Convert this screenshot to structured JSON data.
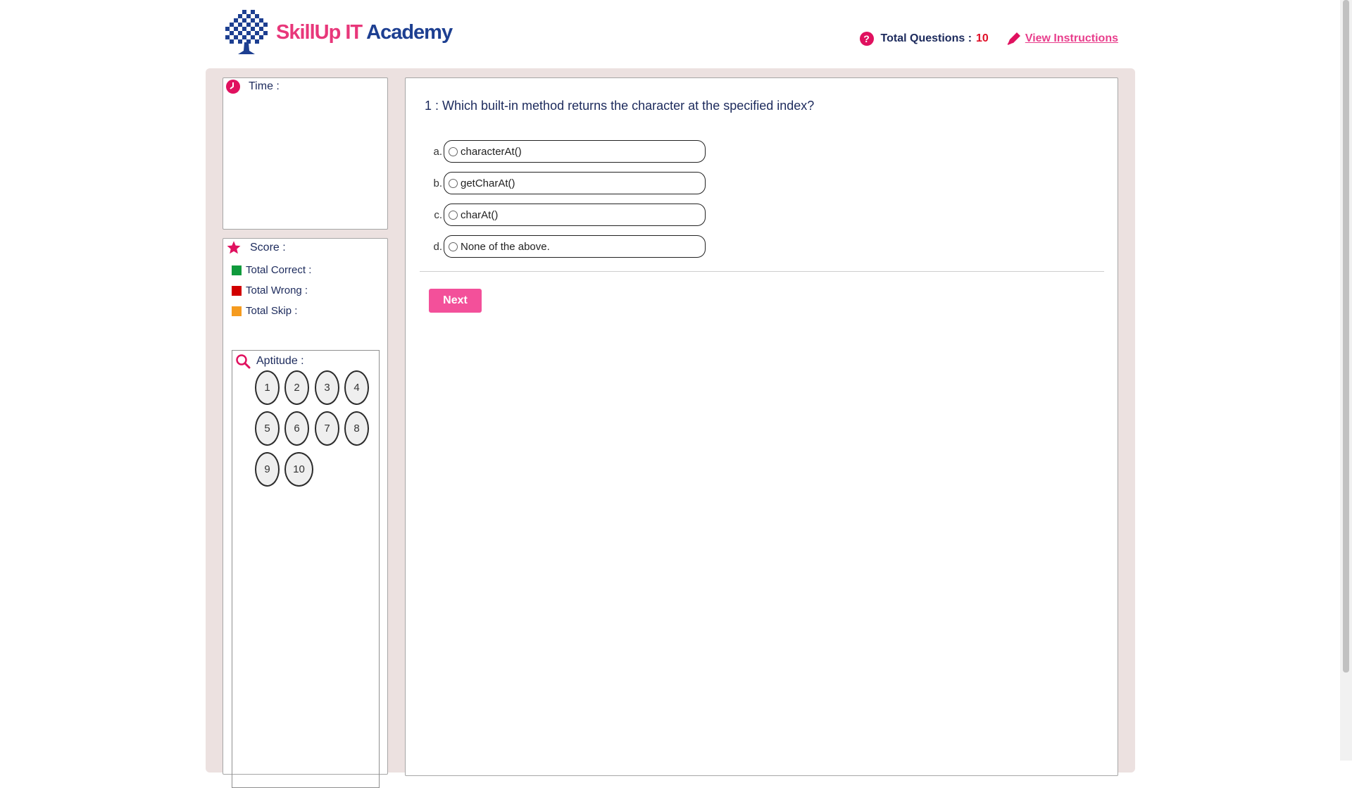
{
  "header": {
    "brand_part1": "SkillUp",
    "brand_part2": "IT",
    "brand_part3": "Academy",
    "total_questions_label": "Total Questions :",
    "total_questions_value": "10",
    "view_instructions": "View Instructions"
  },
  "time": {
    "label": "Time :"
  },
  "score": {
    "label": "Score :",
    "legend": [
      {
        "label": "Total Correct :",
        "color": "#0f9a3c"
      },
      {
        "label": "Total Wrong :",
        "color": "#d10000"
      },
      {
        "label": "Total Skip :",
        "color": "#f59b1f"
      }
    ]
  },
  "aptitude": {
    "label": "Aptitude :",
    "numbers": [
      "1",
      "2",
      "3",
      "4",
      "5",
      "6",
      "7",
      "8",
      "9",
      "10"
    ]
  },
  "question": {
    "text": "1 : Which built-in method returns the character at the specified index?",
    "options": [
      {
        "letter": "a.",
        "text": "characterAt()"
      },
      {
        "letter": "b.",
        "text": "getCharAt()"
      },
      {
        "letter": "c.",
        "text": "charAt()"
      },
      {
        "letter": "d.",
        "text": "None of the above."
      }
    ],
    "next_label": "Next"
  },
  "colors": {
    "accent": "#e8377a",
    "navy": "#1c2a5c",
    "next": "#f3509a"
  }
}
